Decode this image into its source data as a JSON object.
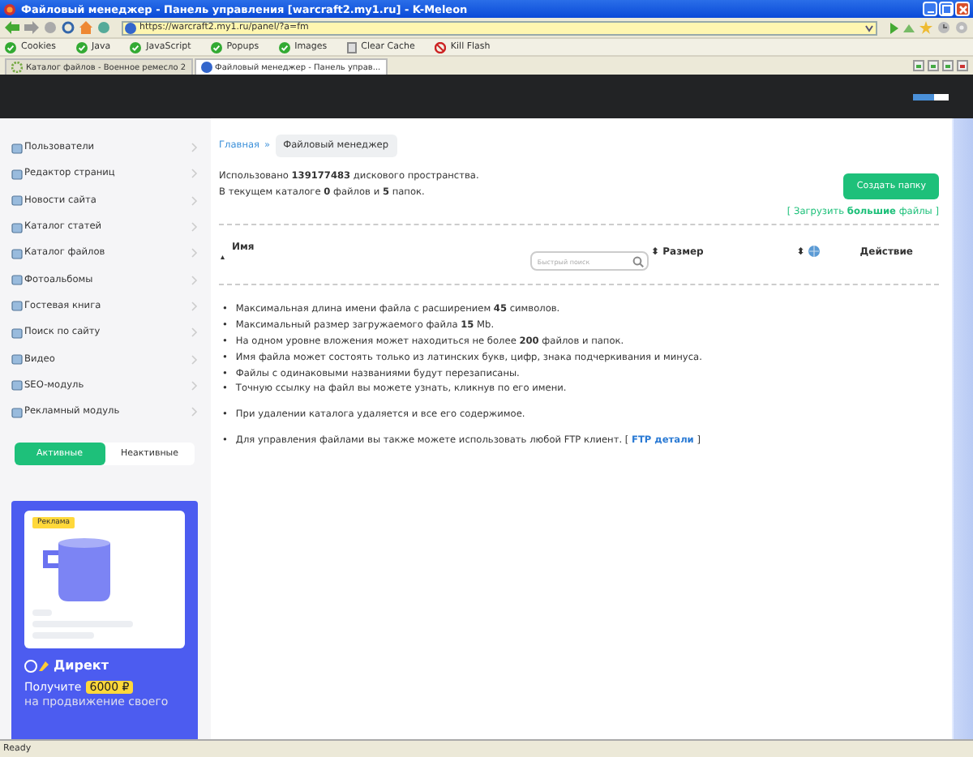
{
  "window": {
    "title": "Файловый менеджер - Панель управления [warcraft2.my1.ru] - K-Meleon"
  },
  "address_bar": {
    "url": "https://warcraft2.my1.ru/panel/?a=fm"
  },
  "bookmarks": [
    {
      "label": "Cookies",
      "kind": "check"
    },
    {
      "label": "Java",
      "kind": "check"
    },
    {
      "label": "JavaScript",
      "kind": "check"
    },
    {
      "label": "Popups",
      "kind": "check"
    },
    {
      "label": "Images",
      "kind": "check"
    },
    {
      "label": "Clear Cache",
      "kind": "clear"
    },
    {
      "label": "Kill Flash",
      "kind": "kill"
    }
  ],
  "tabs": [
    {
      "label": "Каталог файлов - Военное ремесло 2",
      "selected": false
    },
    {
      "label": "Файловый менеджер - Панель управ...",
      "selected": true
    }
  ],
  "sidebar": {
    "items": [
      {
        "label": "Пользователи"
      },
      {
        "label": "Редактор страниц"
      },
      {
        "label": "Новости сайта"
      },
      {
        "label": "Каталог статей"
      },
      {
        "label": "Каталог файлов"
      },
      {
        "label": "Фотоальбомы"
      },
      {
        "label": "Гостевая книга"
      },
      {
        "label": "Поиск по сайту"
      },
      {
        "label": "Видео"
      },
      {
        "label": "SEO-модуль"
      },
      {
        "label": "Рекламный модуль"
      }
    ],
    "filter_tabs": [
      {
        "label": "Активные",
        "selected": true
      },
      {
        "label": "Неактивные",
        "selected": false
      }
    ],
    "ad": {
      "badge": "Реклама",
      "brand": "Директ",
      "offer": "Получите",
      "amount": "6000 ₽",
      "line": "на продвижение своего"
    }
  },
  "breadcrumb": {
    "home": "Главная",
    "separator": "»",
    "current": "Файловый менеджер"
  },
  "summary": [
    "Использовано **139177483** дискового пространства.",
    "В текущем каталоге **0** файлов и **5** папок."
  ],
  "create_button": "Создать папку",
  "upload_link": "[ Загрузить **большие** файлы ]",
  "table": {
    "columns": [
      {
        "label": "Имя",
        "kind": "text",
        "sort": "▴"
      },
      {
        "kind": "search",
        "placeholder": "Быстрый поиск"
      },
      {
        "label": "Размер",
        "kind": "text",
        "sort": "⬍"
      },
      {
        "kind": "icon",
        "sort": "⬍"
      },
      {
        "label": "Действие",
        "kind": "text"
      }
    ]
  },
  "bullet": "•",
  "notes": [
    [
      {
        "text": "Максимальная длина имени файла с расширением **45** символов."
      },
      {
        "text": "Максимальный размер загружаемого файла **15** Mb."
      },
      {
        "text": "На одном уровне вложения может находиться не более **200** файлов и папок."
      },
      {
        "text": "Имя файла может состоять только из латинских букв, цифр, знака подчеркивания и минуса."
      },
      {
        "text": "Файлы с одинаковыми названиями будут перезаписаны."
      },
      {
        "text": "Точную ссылку на файл вы можете узнать, кликнув по его имени."
      }
    ],
    [
      {
        "text": "При удалении каталога удаляется и все его содержимое."
      }
    ],
    [
      {
        "text": "Для управления файлами вы также можете использовать любой FTP клиент. [ ",
        "link": "FTP детали",
        "after": " ]"
      }
    ]
  ],
  "status_bar": "Ready"
}
